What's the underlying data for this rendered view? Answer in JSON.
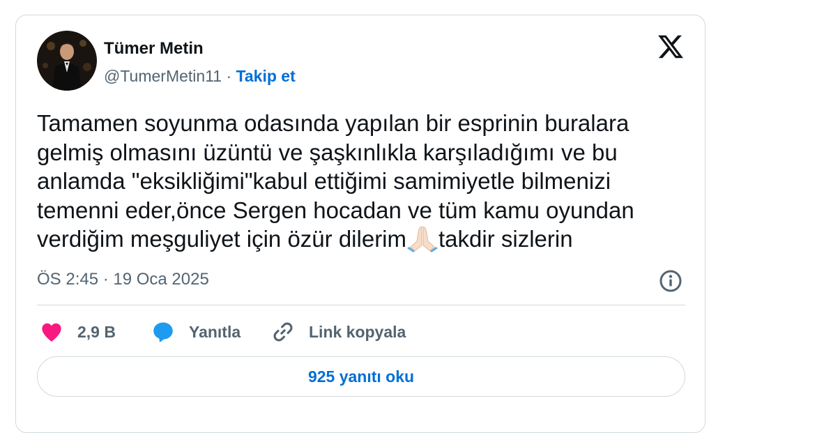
{
  "author": {
    "name": "Tümer Metin",
    "handle": "@TumerMetin11",
    "separator": " · ",
    "follow_label": "Takip et"
  },
  "tweet": {
    "text_before_emoji": "Tamamen soyunma odasında yapılan bir esprinin buralara gelmiş olmasını üzüntü ve şaşkınlıkla karşıladığımı ve bu anlamda \"eksikliğimi\"kabul ettiğimi samimiyetle bilmenizi temenni eder,önce Sergen hocadan ve tüm kamu oyundan verdiğim meşguliyet için özür dilerim",
    "emoji": "folded-hands-icon",
    "text_after_emoji": "takdir sizlerin",
    "timestamp": "ÖS 2:45 · 19 Oca 2025"
  },
  "actions": {
    "like_count": "2,9 B",
    "reply_label": "Yanıtla",
    "copy_link_label": "Link kopyala",
    "read_replies_label": "925 yanıtı oku"
  },
  "colors": {
    "accent": "#006fd6",
    "like": "#f91880",
    "reply": "#1d9bf0",
    "muted": "#536471",
    "border": "#cfd9de"
  }
}
